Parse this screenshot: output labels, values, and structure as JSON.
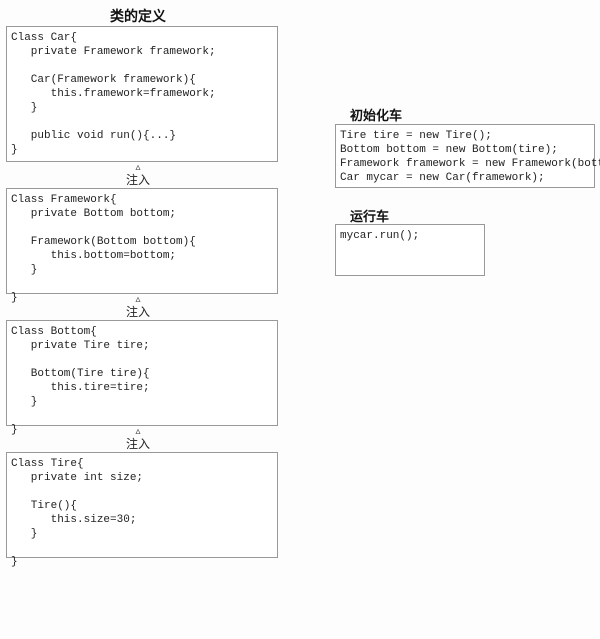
{
  "headings": {
    "class_def": "类的定义",
    "init_car": "初始化车",
    "run_car": "运行车"
  },
  "arrow_label": "注入",
  "classes": {
    "car": "Class Car{\n   private Framework framework;\n\n   Car(Framework framework){\n      this.framework=framework;\n   }\n\n   public void run(){...}\n}",
    "framework": "Class Framework{\n   private Bottom bottom;\n\n   Framework(Bottom bottom){\n      this.bottom=bottom;\n   }\n\n}",
    "bottom": "Class Bottom{\n   private Tire tire;\n\n   Bottom(Tire tire){\n      this.tire=tire;\n   }\n\n}",
    "tire": "Class Tire{\n   private int size;\n\n   Tire(){\n      this.size=30;\n   }\n\n}"
  },
  "init_code": "Tire tire = new Tire();\nBottom bottom = new Bottom(tire);\nFramework framework = new Framework(bottom);\nCar mycar = new Car(framework);",
  "run_code": "mycar.run();\n\n"
}
